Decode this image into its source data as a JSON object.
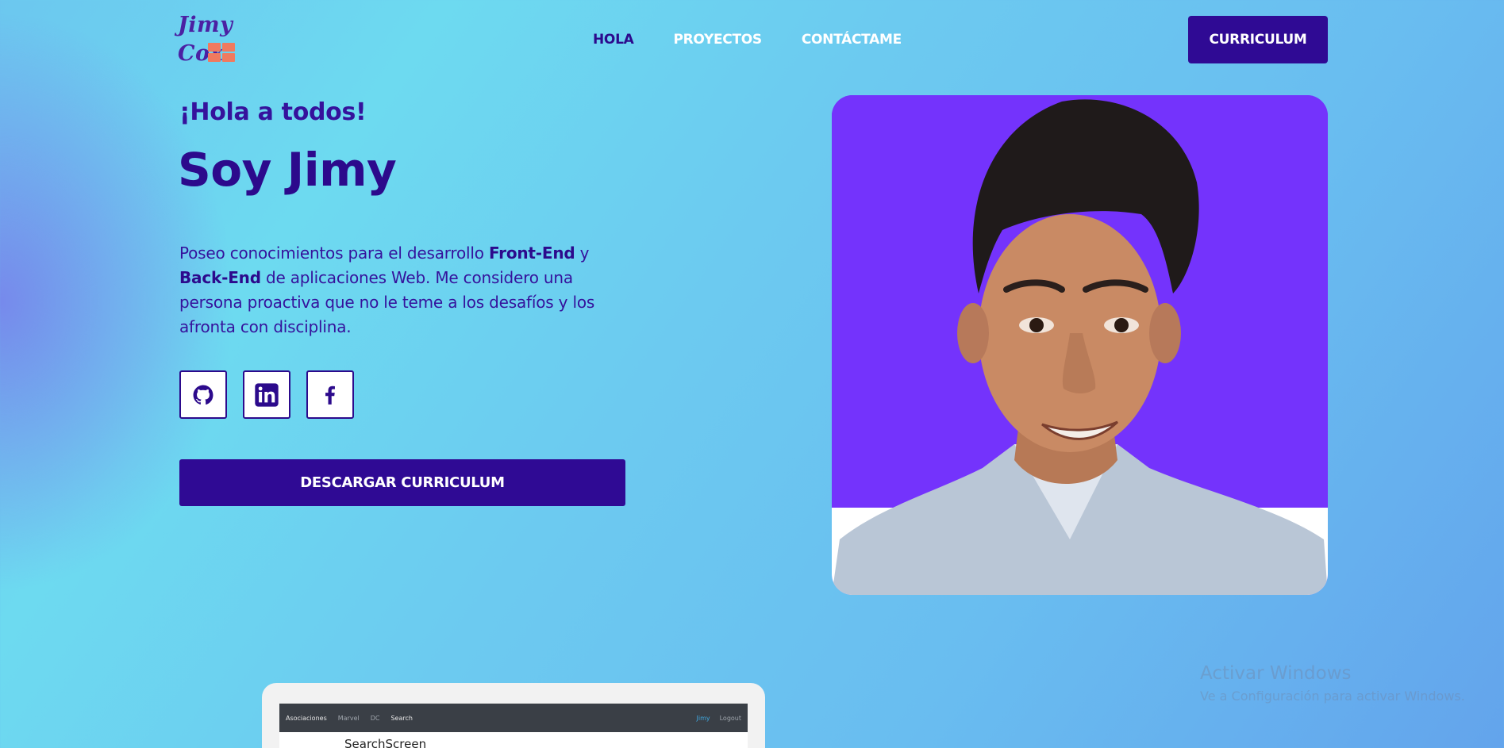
{
  "header": {
    "logo_text": "Jimy Cox",
    "nav": [
      {
        "label": "HOLA"
      },
      {
        "label": "PROYECTOS"
      },
      {
        "label": "CONTÁCTAME"
      }
    ],
    "cv_button": "CURRICULUM"
  },
  "hero": {
    "greeting": "¡Hola a todos!",
    "headline": "Soy Jimy",
    "bio": {
      "part1": "Poseo conocimientos para el desarrollo ",
      "bold1": "Front-End",
      "part2": " y ",
      "bold2": "Back-End",
      "part3": " de aplicaciones Web. Me considero una persona proactiva que no le teme a los desafíos y los afronta con disciplina."
    },
    "socials": [
      {
        "icon": "github-icon"
      },
      {
        "icon": "linkedin-icon"
      },
      {
        "icon": "facebook-icon"
      }
    ],
    "download_button": "DESCARGAR CURRICULUM"
  },
  "project_preview": {
    "brand": "Asociaciones",
    "links": [
      "Marvel",
      "DC",
      "Search"
    ],
    "user": "Jimy",
    "logout": "Logout",
    "screen_title": "SearchScreen"
  },
  "os_watermark": {
    "line1": "Activar Windows",
    "line2": "Ve a Configuración para activar Windows."
  },
  "colors": {
    "primary": "#2f0a94",
    "photo_bg": "#7433fc",
    "logo_accent": "#f07a5f"
  }
}
